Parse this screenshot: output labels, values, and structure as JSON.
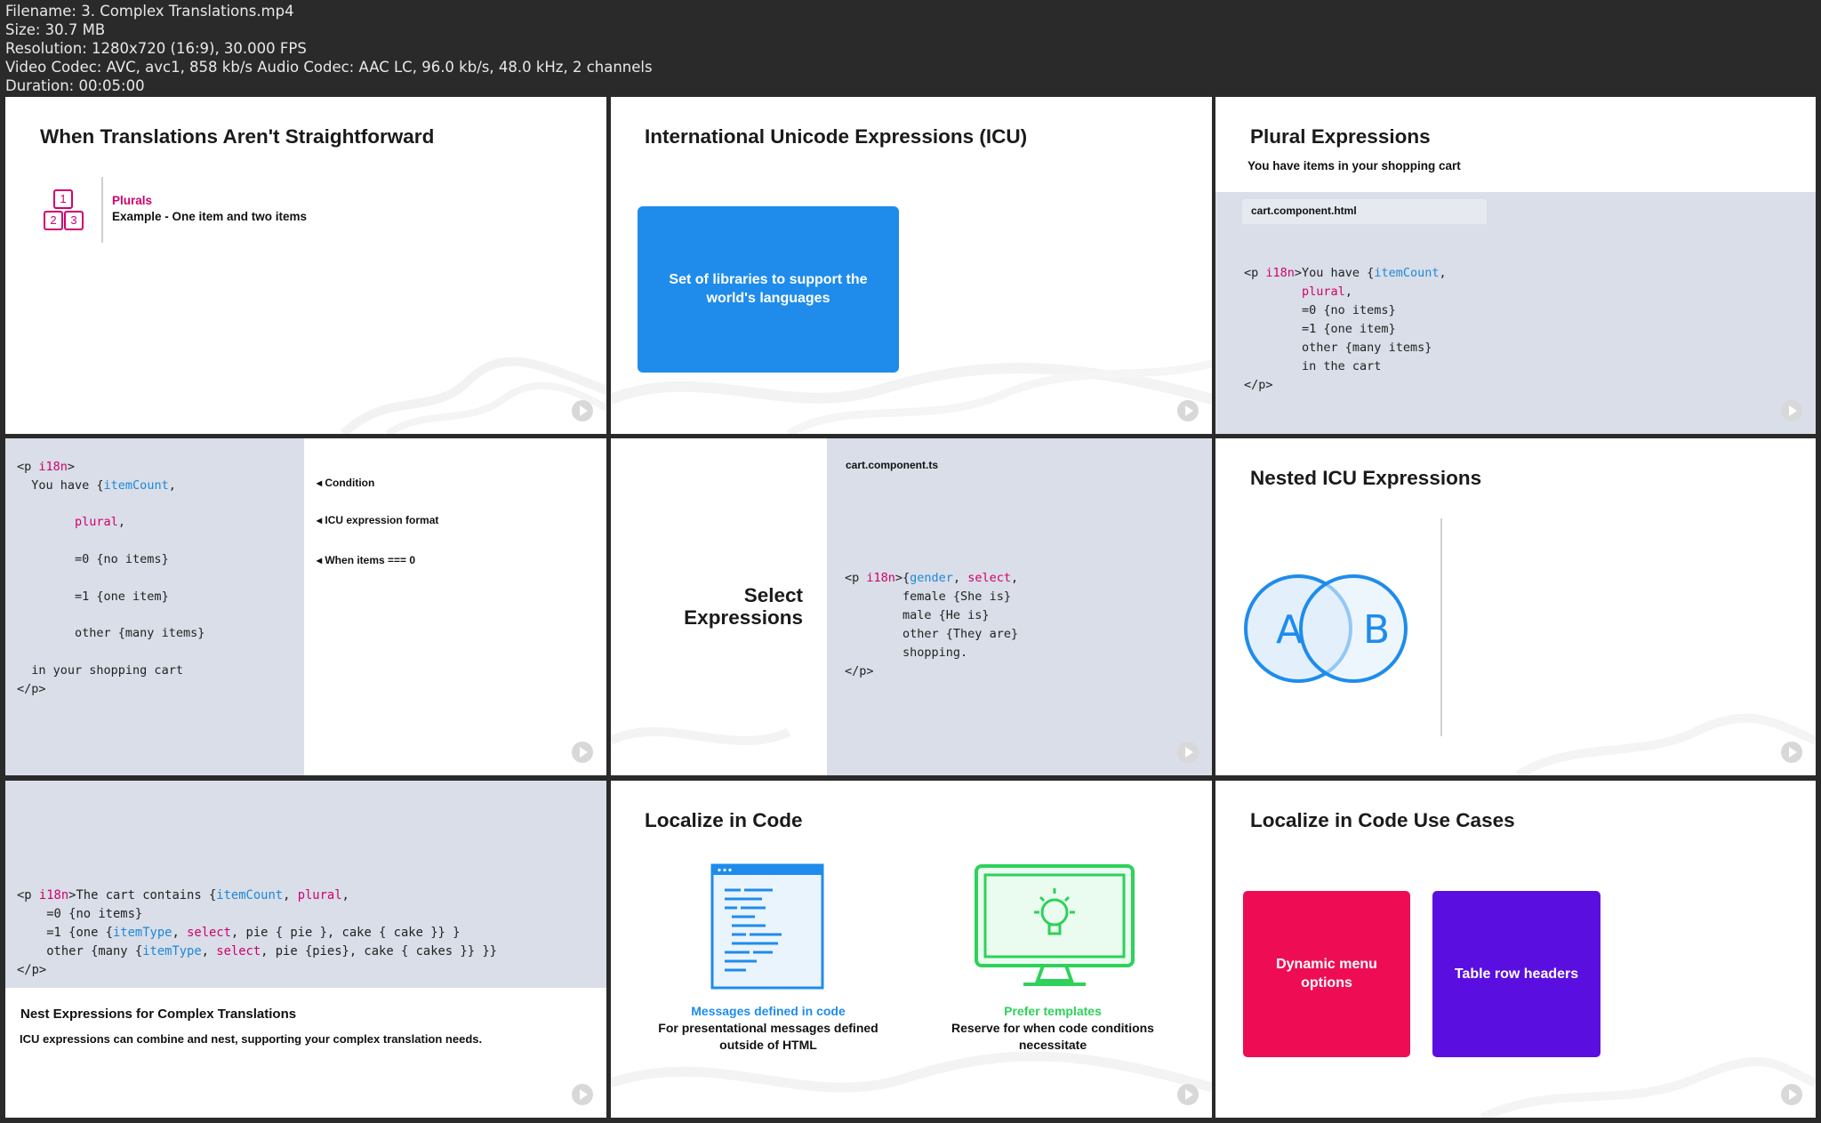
{
  "file_info": {
    "filename": "Filename: 3. Complex Translations.mp4",
    "size": "Size: 30.7 MB",
    "resolution": "Resolution: 1280x720 (16:9), 30.000 FPS",
    "codec": "Video Codec: AVC, avc1, 858 kb/s Audio Codec: AAC LC, 96.0 kb/s, 48.0 kHz, 2 channels",
    "duration": "Duration: 00:05:00"
  },
  "slide1": {
    "title": "When Translations Aren't Straightforward",
    "label": "Plurals",
    "example": "Example - One item and two items",
    "icon_digits": [
      "1",
      "2",
      "3"
    ]
  },
  "slide2": {
    "title": "International Unicode Expressions (ICU)",
    "box_line1": "Set of libraries to support the",
    "box_line2": "world's languages"
  },
  "slide3": {
    "title": "Plural Expressions",
    "subtitle": "You have items in your shopping cart",
    "tab": "cart.component.html",
    "code": {
      "l1a": "<p ",
      "l1k": "i18n",
      "l1b": ">You have {",
      "l1v": "itemCount",
      "l1c": ",",
      "l2": "plural",
      "l2c": ",",
      "l3": "=0 {no items}",
      "l4": "=1 {one item}",
      "l5": "other {many items}",
      "l6": "in the cart",
      "l7": "</p>"
    }
  },
  "slide4": {
    "code": {
      "l1a": "<p ",
      "l1k": "i18n",
      "l1b": ">",
      "l2a": "You have {",
      "l2v": "itemCount",
      "l2b": ",",
      "l3": "plural",
      "l3c": ",",
      "l4": "=0 {no items}",
      "l5": "=1 {one item}",
      "l6": "other {many items}",
      "l7": "in your shopping cart",
      "l8": "</p>"
    },
    "annotations": [
      "◂ Condition",
      "◂ ICU expression format",
      "◂ When items === 0"
    ]
  },
  "slide5": {
    "title_line1": "Select",
    "title_line2": "Expressions",
    "tab": "cart.component.ts",
    "code": {
      "l1a": "<p ",
      "l1k": "i18n",
      "l1b": ">{",
      "l1v": "gender",
      "l1c": ", ",
      "l1s": "select",
      "l1d": ",",
      "l2": "female {She is}",
      "l3": "male {He is}",
      "l4": "other {They are}",
      "l5": "shopping.",
      "l6": "</p>"
    }
  },
  "slide6": {
    "title": "Nested ICU Expressions",
    "circle_a": "A",
    "circle_b": "B"
  },
  "slide7": {
    "code": {
      "l1a": "<p ",
      "l1k": "i18n",
      "l1b": ">The cart contains {",
      "l1v": "itemCount",
      "l1c": ", ",
      "l1p": "plural",
      "l1d": ",",
      "l2": "=0 {no items}",
      "l3a": "=1 {one {",
      "l3v": "itemType",
      "l3b": ", ",
      "l3s": "select",
      "l3c": ", pie { pie }, cake { cake }} }",
      "l4a": "other {many {",
      "l4v": "itemType",
      "l4b": ", ",
      "l4s": "select",
      "l4c": ", pie {pies}, cake { cakes }} }}",
      "l5": "</p>"
    },
    "heading": "Nest Expressions for Complex Translations",
    "body": "ICU expressions can combine and nest, supporting your complex translation needs."
  },
  "slide8": {
    "title": "Localize in Code",
    "left_caption_title": "Messages defined in code",
    "left_caption_line1": "For presentational messages defined",
    "left_caption_line2": "outside of HTML",
    "right_caption_title": "Prefer templates",
    "right_caption_line1": "Reserve for when code conditions",
    "right_caption_line2": "necessitate"
  },
  "slide9": {
    "title": "Localize in Code Use Cases",
    "card1_line1": "Dynamic menu",
    "card1_line2": "options",
    "card2": "Table row headers"
  },
  "colors": {
    "pink": "#d1006b",
    "blue_box": "#1f8ceb",
    "code_bg": "#d9dee8",
    "green": "#2ed15a",
    "red_card": "#ee0d55",
    "purple_card": "#5a0fe0"
  }
}
